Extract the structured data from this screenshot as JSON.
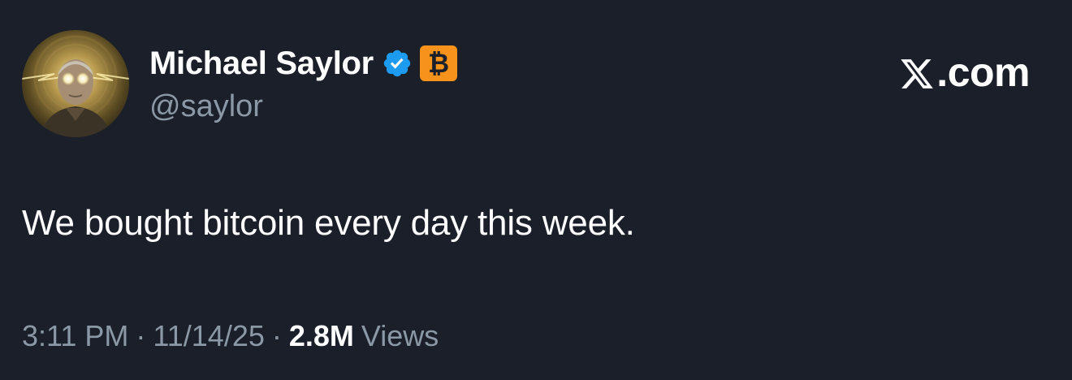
{
  "author": {
    "display_name": "Michael Saylor",
    "handle": "@saylor",
    "verified_icon": "verified-badge-icon",
    "badge_icon": "bitcoin-icon",
    "verified_color": "#1d9bf0",
    "badge_color": "#f7931a",
    "avatar_icon": "profile-avatar"
  },
  "site": {
    "logo_text": ".com",
    "logo_icon": "x-logo-icon"
  },
  "post": {
    "text": "We bought bitcoin every day this week."
  },
  "meta": {
    "time": "3:11 PM",
    "separator": "·",
    "date": "11/14/25",
    "views_count": "2.8M",
    "views_label": "Views"
  },
  "colors": {
    "background": "#1a1f29",
    "primary_text": "#ffffff",
    "secondary_text": "#8b98a5"
  }
}
